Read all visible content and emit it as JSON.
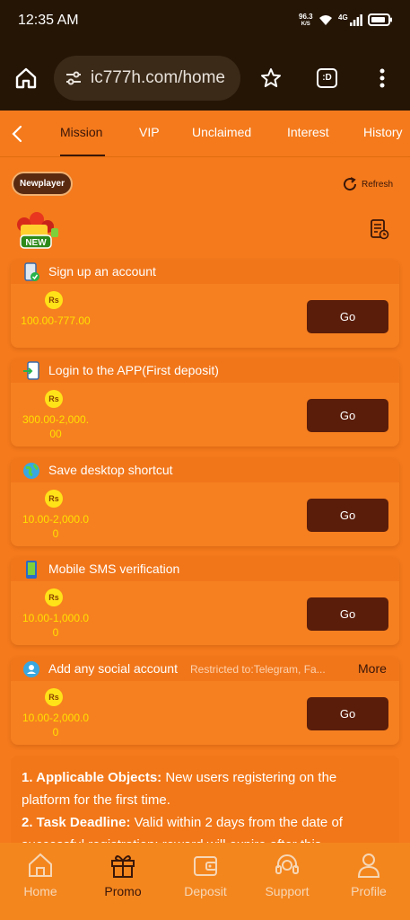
{
  "status_bar": {
    "time": "12:35 AM",
    "net_speed": "96.3",
    "net_unit": "K/S",
    "network": "4G"
  },
  "browser": {
    "url": "ic777h.com/home",
    "tabs_label": ":D"
  },
  "tabs": [
    "Mission",
    "VIP",
    "Unclaimed",
    "Interest",
    "History"
  ],
  "filter": {
    "label": "Newplayer",
    "refresh": "Refresh",
    "badge": "NEW"
  },
  "coin_label": "Rs",
  "go_label": "Go",
  "tasks": [
    {
      "name": "Sign up an account",
      "reward": "100.00-777.00"
    },
    {
      "name": "Login to the APP(First deposit)",
      "reward": "300.00-2,000.00"
    },
    {
      "name": "Save desktop shortcut",
      "reward": "10.00-2,000.00"
    },
    {
      "name": "Mobile SMS verification",
      "reward": "10.00-1,000.00"
    },
    {
      "name": "Add any social account",
      "reward": "10.00-2,000.00",
      "restriction": "Restricted to:Telegram, Fa...",
      "more": "More"
    }
  ],
  "rules": [
    {
      "label": "1. Applicable Objects:",
      "text": " New users registering on the platform for the first time."
    },
    {
      "label": "2. Task Deadline:",
      "text": " Valid within 2 days from the date of successful registration; reward will expire after this"
    }
  ],
  "bottom_nav": [
    "Home",
    "Promo",
    "Deposit",
    "Support",
    "Profile"
  ],
  "colors": {
    "background": "#F47A1C",
    "button": "#5a1d0a",
    "reward": "#FFE000",
    "coin": "#FFE318"
  }
}
